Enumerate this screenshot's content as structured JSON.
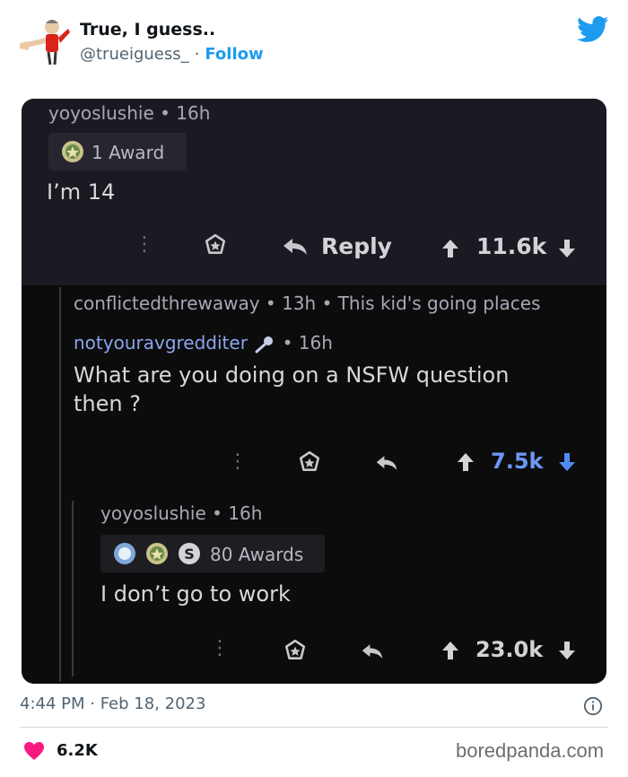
{
  "tweet": {
    "author_name": "True, I guess..",
    "author_handle": "@trueiguess_",
    "separator": "·",
    "follow_label": "Follow",
    "timestamp": "4:44 PM · Feb 18, 2023",
    "likes": "6.2K",
    "watermark": "boredpanda.com"
  },
  "comments": [
    {
      "username": "yoyoslushie",
      "time": "• 16h",
      "awards": "1 Award",
      "body": "I’m 14",
      "reply_label": "Reply",
      "score": "11.6k"
    },
    {
      "header": "conflictedthrewaway • 13h • This kid's going places",
      "username": "notyouravgredditer",
      "time": "• 16h",
      "body_line1": "What are you doing on a NSFW question",
      "body_line2": "then ?",
      "score": "7.5k"
    },
    {
      "username": "yoyoslushie",
      "time": "• 16h",
      "awards": "80 Awards",
      "body": "I don’t go to work",
      "score": "23.0k"
    }
  ],
  "colors": {
    "twitter_blue": "#1d9bf0",
    "like_pink": "#f91880",
    "upvote_blue": "#4e8ef4"
  }
}
